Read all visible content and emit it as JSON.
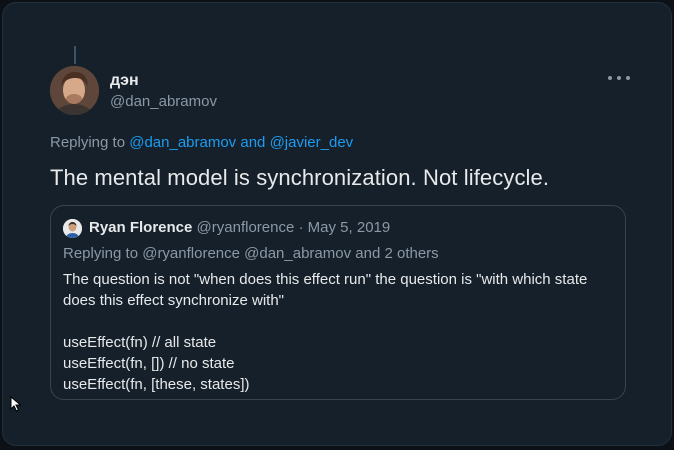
{
  "tweet": {
    "display_name": "дэн",
    "handle": "@dan_abramov",
    "replying_prefix": "Replying to",
    "replying_user1": "@dan_abramov",
    "replying_and": "and",
    "replying_user2": "@javier_dev",
    "text": "The mental model is synchronization. Not lifecycle."
  },
  "quote": {
    "author_name": "Ryan Florence",
    "author_handle": "@ryanflorence",
    "separator": "·",
    "date": "May 5, 2019",
    "replying": "Replying to @ryanflorence @dan_abramov and 2 others",
    "body_line1": "The question is not \"when does this effect run\" the question is \"with which state",
    "body_line2": "does this effect synchronize with\"",
    "code_line1": "useEffect(fn) // all state",
    "code_line2": "useEffect(fn, []) // no state",
    "code_line3": "useEffect(fn, [these, states])"
  },
  "icons": {
    "more": "more-horizontal-icon",
    "cursor": "mouse-pointer-icon"
  },
  "colors": {
    "background": "#15202b",
    "text": "#e7e9ea",
    "muted": "#8b98a5",
    "link": "#1d9bf0",
    "border": "#38444d"
  }
}
